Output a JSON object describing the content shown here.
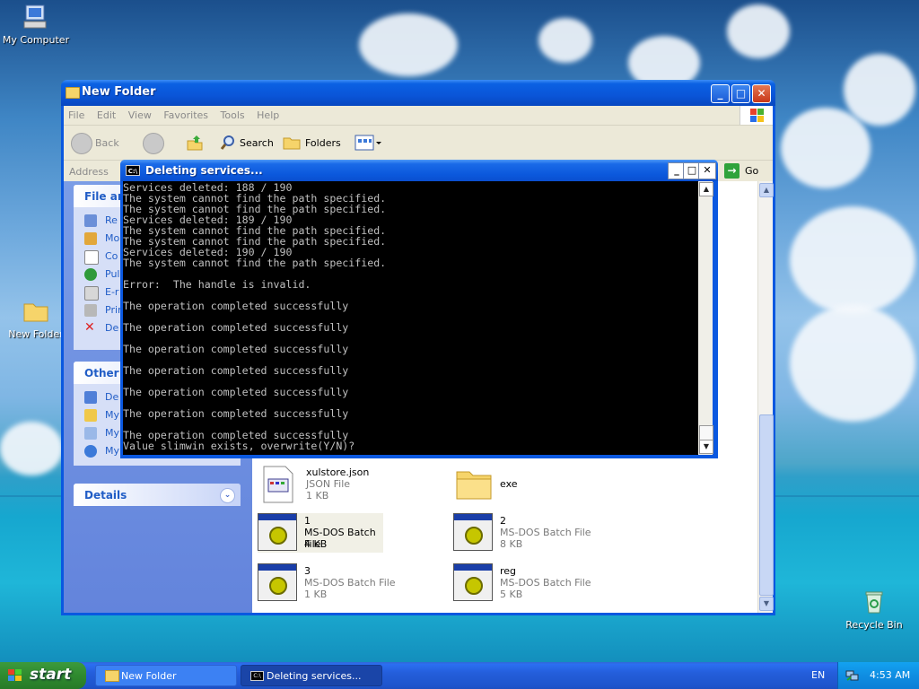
{
  "desktop": {
    "icons": {
      "my_computer": "My Computer",
      "new_folder": "New Folder",
      "recycle_bin": "Recycle Bin"
    }
  },
  "explorer": {
    "title": "New Folder",
    "menu": [
      "File",
      "Edit",
      "View",
      "Favorites",
      "Tools",
      "Help"
    ],
    "toolbar": {
      "back": "Back",
      "search": "Search",
      "folders": "Folders"
    },
    "address_label": "Address",
    "go_label": "Go",
    "tasks": {
      "file_header": "File an",
      "file_items": [
        "Re",
        "Mo",
        "Co",
        "Pul",
        "E-r",
        "Prin",
        "De"
      ],
      "other_header": "Other I",
      "other_items": [
        "De",
        "My",
        "My",
        "My Network Places"
      ],
      "details_header": "Details"
    },
    "files": [
      {
        "name": "xulstore.json",
        "type": "JSON File",
        "size": "1 KB"
      },
      {
        "name": "exe",
        "type": "",
        "size": ""
      },
      {
        "name": "1",
        "type": "MS-DOS Batch File",
        "size": "4 KB"
      },
      {
        "name": "2",
        "type": "MS-DOS Batch File",
        "size": "8 KB"
      },
      {
        "name": "3",
        "type": "MS-DOS Batch File",
        "size": "1 KB"
      },
      {
        "name": "reg",
        "type": "MS-DOS Batch File",
        "size": "5 KB"
      }
    ]
  },
  "cmd": {
    "title": "Deleting services...",
    "output": "Services deleted: 188 / 190\nThe system cannot find the path specified.\nThe system cannot find the path specified.\nServices deleted: 189 / 190\nThe system cannot find the path specified.\nThe system cannot find the path specified.\nServices deleted: 190 / 190\nThe system cannot find the path specified.\n\nError:  The handle is invalid.\n\nThe operation completed successfully\n\nThe operation completed successfully\n\nThe operation completed successfully\n\nThe operation completed successfully\n\nThe operation completed successfully\n\nThe operation completed successfully\n\nThe operation completed successfully\nValue slimwin exists, overwrite(Y/N)?"
  },
  "taskbar": {
    "start_label": "start",
    "tasks": [
      "New Folder",
      "Deleting services..."
    ],
    "language": "EN",
    "clock": "4:53 AM"
  }
}
